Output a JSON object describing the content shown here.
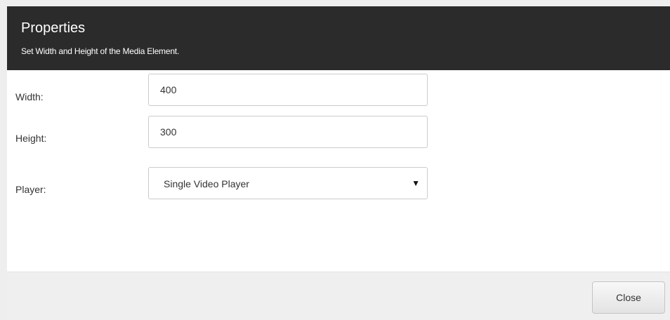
{
  "dialog": {
    "title": "Properties",
    "subtitle": "Set Width and Height of the Media Element."
  },
  "form": {
    "width": {
      "label": "Width:",
      "value": "400"
    },
    "height": {
      "label": "Height:",
      "value": "300"
    },
    "player": {
      "label": "Player:",
      "selected": "Single Video Player",
      "arrow": "▼"
    }
  },
  "footer": {
    "close_label": "Close"
  }
}
